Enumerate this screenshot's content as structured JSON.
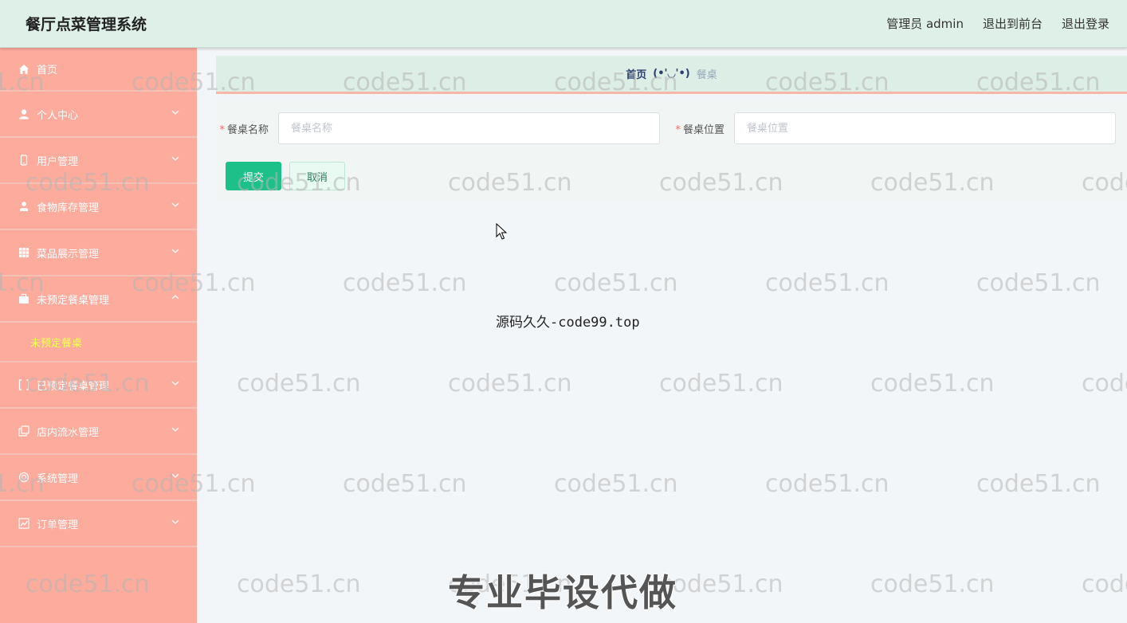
{
  "app": {
    "title": "餐厅点菜管理系统"
  },
  "header": {
    "user_label": "管理员 admin",
    "to_front_label": "退出到前台",
    "logout_label": "退出登录"
  },
  "sidebar": {
    "items": [
      {
        "label": "首页",
        "icon": "home-icon"
      },
      {
        "label": "个人中心",
        "icon": "user-icon"
      },
      {
        "label": "用户管理",
        "icon": "phone-icon"
      },
      {
        "label": "食物库存管理",
        "icon": "person-icon"
      },
      {
        "label": "菜品展示管理",
        "icon": "grid-icon"
      },
      {
        "label": "未预定餐桌管理",
        "icon": "briefcase-icon"
      },
      {
        "label": "已预定餐桌管理",
        "icon": "brackets-icon"
      },
      {
        "label": "店内流水管理",
        "icon": "copy-icon"
      },
      {
        "label": "系统管理",
        "icon": "target-icon"
      },
      {
        "label": "订单管理",
        "icon": "chart-icon"
      }
    ],
    "submenu": {
      "label": "未预定餐桌"
    }
  },
  "breadcrumb": {
    "home": "首页",
    "separator": "(•'◡'•)",
    "current": "餐桌"
  },
  "form": {
    "name_label": "餐桌名称",
    "name_placeholder": "餐桌名称",
    "name_value": "",
    "location_label": "餐桌位置",
    "location_placeholder": "餐桌位置",
    "location_value": "",
    "required_mark": "*",
    "submit_label": "提交",
    "cancel_label": "取消"
  },
  "overlays": {
    "source_text": "源码久久-code99.top",
    "promo_text": "专业毕设代做",
    "watermark": "code51.cn"
  },
  "colors": {
    "sidebar_bg": "#fdab9c",
    "header_bg": "#dff0e8",
    "submit_bg": "#1ec08a",
    "submenu_text": "#f7ff56"
  }
}
